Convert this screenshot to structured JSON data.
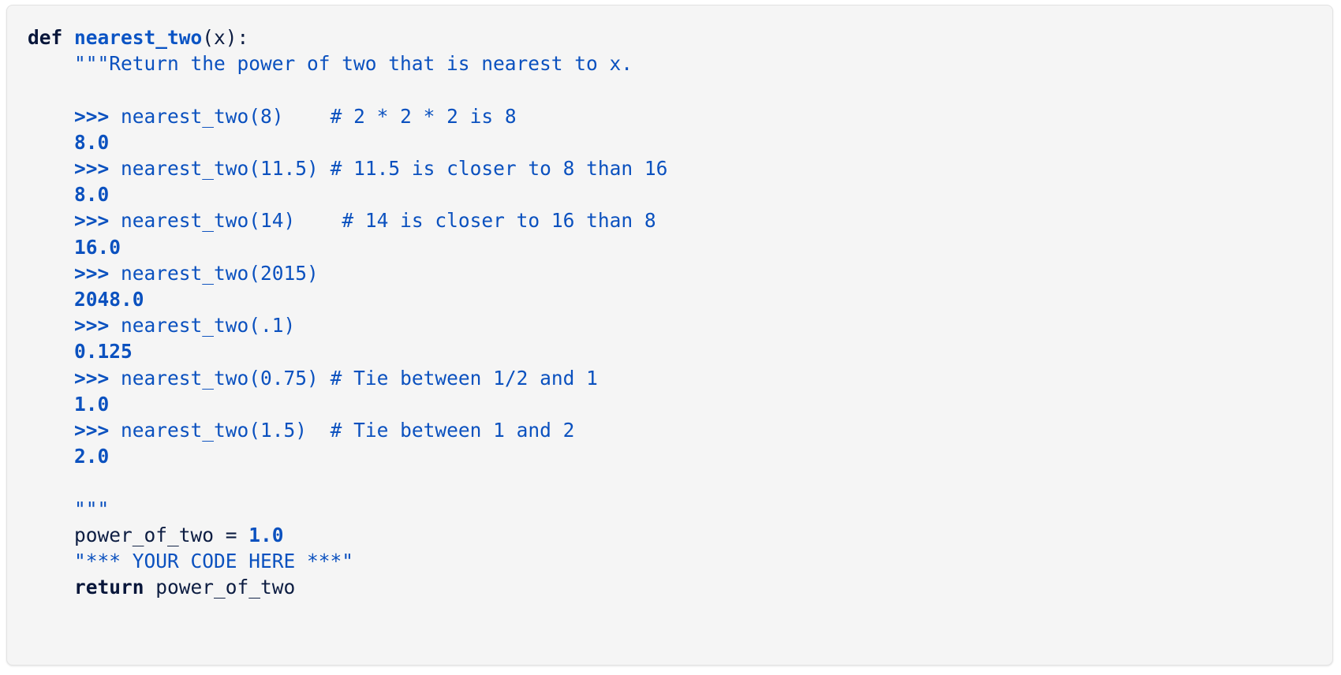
{
  "editor": {
    "language": "python",
    "background_color": "#f5f5f5",
    "border_color": "#e3e3e3",
    "keyword_color": "#08163a",
    "function_name_color": "#0b54c4",
    "string_color": "#0b51bf",
    "plain_color": "#0d1d42"
  },
  "code": {
    "function_name": "nearest_two",
    "def_keyword": "def",
    "signature_params": "(x):",
    "return_keyword": "return",
    "return_value": "power_of_two",
    "assign_name": "power_of_two",
    "assign_operator": " = ",
    "assign_value": "1.0",
    "placeholder_string": "\"*** YOUR CODE HERE ***\"",
    "docstring_open": "\"\"\"",
    "docstring_close": "\"\"\"",
    "docstring_summary": "Return the power of two that is nearest to x.",
    "prompt": ">>> ",
    "doctests": [
      {
        "call": "nearest_two(8)",
        "pad": "    ",
        "comment": "# 2 * 2 * 2 is 8",
        "result": "8.0"
      },
      {
        "call": "nearest_two(11.5)",
        "pad": " ",
        "comment": "# 11.5 is closer to 8 than 16",
        "result": "8.0"
      },
      {
        "call": "nearest_two(14)",
        "pad": "    ",
        "comment": "# 14 is closer to 16 than 8",
        "result": "16.0"
      },
      {
        "call": "nearest_two(2015)",
        "pad": "",
        "comment": "",
        "result": "2048.0"
      },
      {
        "call": "nearest_two(.1)",
        "pad": "",
        "comment": "",
        "result": "0.125"
      },
      {
        "call": "nearest_two(0.75)",
        "pad": " ",
        "comment": "# Tie between 1/2 and 1",
        "result": "1.0"
      },
      {
        "call": "nearest_two(1.5)",
        "pad": "  ",
        "comment": "# Tie between 1 and 2",
        "result": "2.0"
      }
    ],
    "lines": [
      "def nearest_two(x):",
      "    \"\"\"Return the power of two that is nearest to x.",
      "",
      "    >>> nearest_two(8)    # 2 * 2 * 2 is 8",
      "    8.0",
      "    >>> nearest_two(11.5) # 11.5 is closer to 8 than 16",
      "    8.0",
      "    >>> nearest_two(14)   # 14 is closer to 16 than 8",
      "    16.0",
      "    >>> nearest_two(2015)",
      "    2048.0",
      "    >>> nearest_two(.1)",
      "    0.125",
      "    >>> nearest_two(0.75) # Tie between 1/2 and 1",
      "    1.0",
      "    >>> nearest_two(1.5)  # Tie between 1 and 2",
      "    2.0",
      "",
      "    \"\"\"",
      "    power_of_two = 1.0",
      "    \"*** YOUR CODE HERE ***\"",
      "    return power_of_two"
    ],
    "indent_1": "    ",
    "indent_2": "    "
  }
}
